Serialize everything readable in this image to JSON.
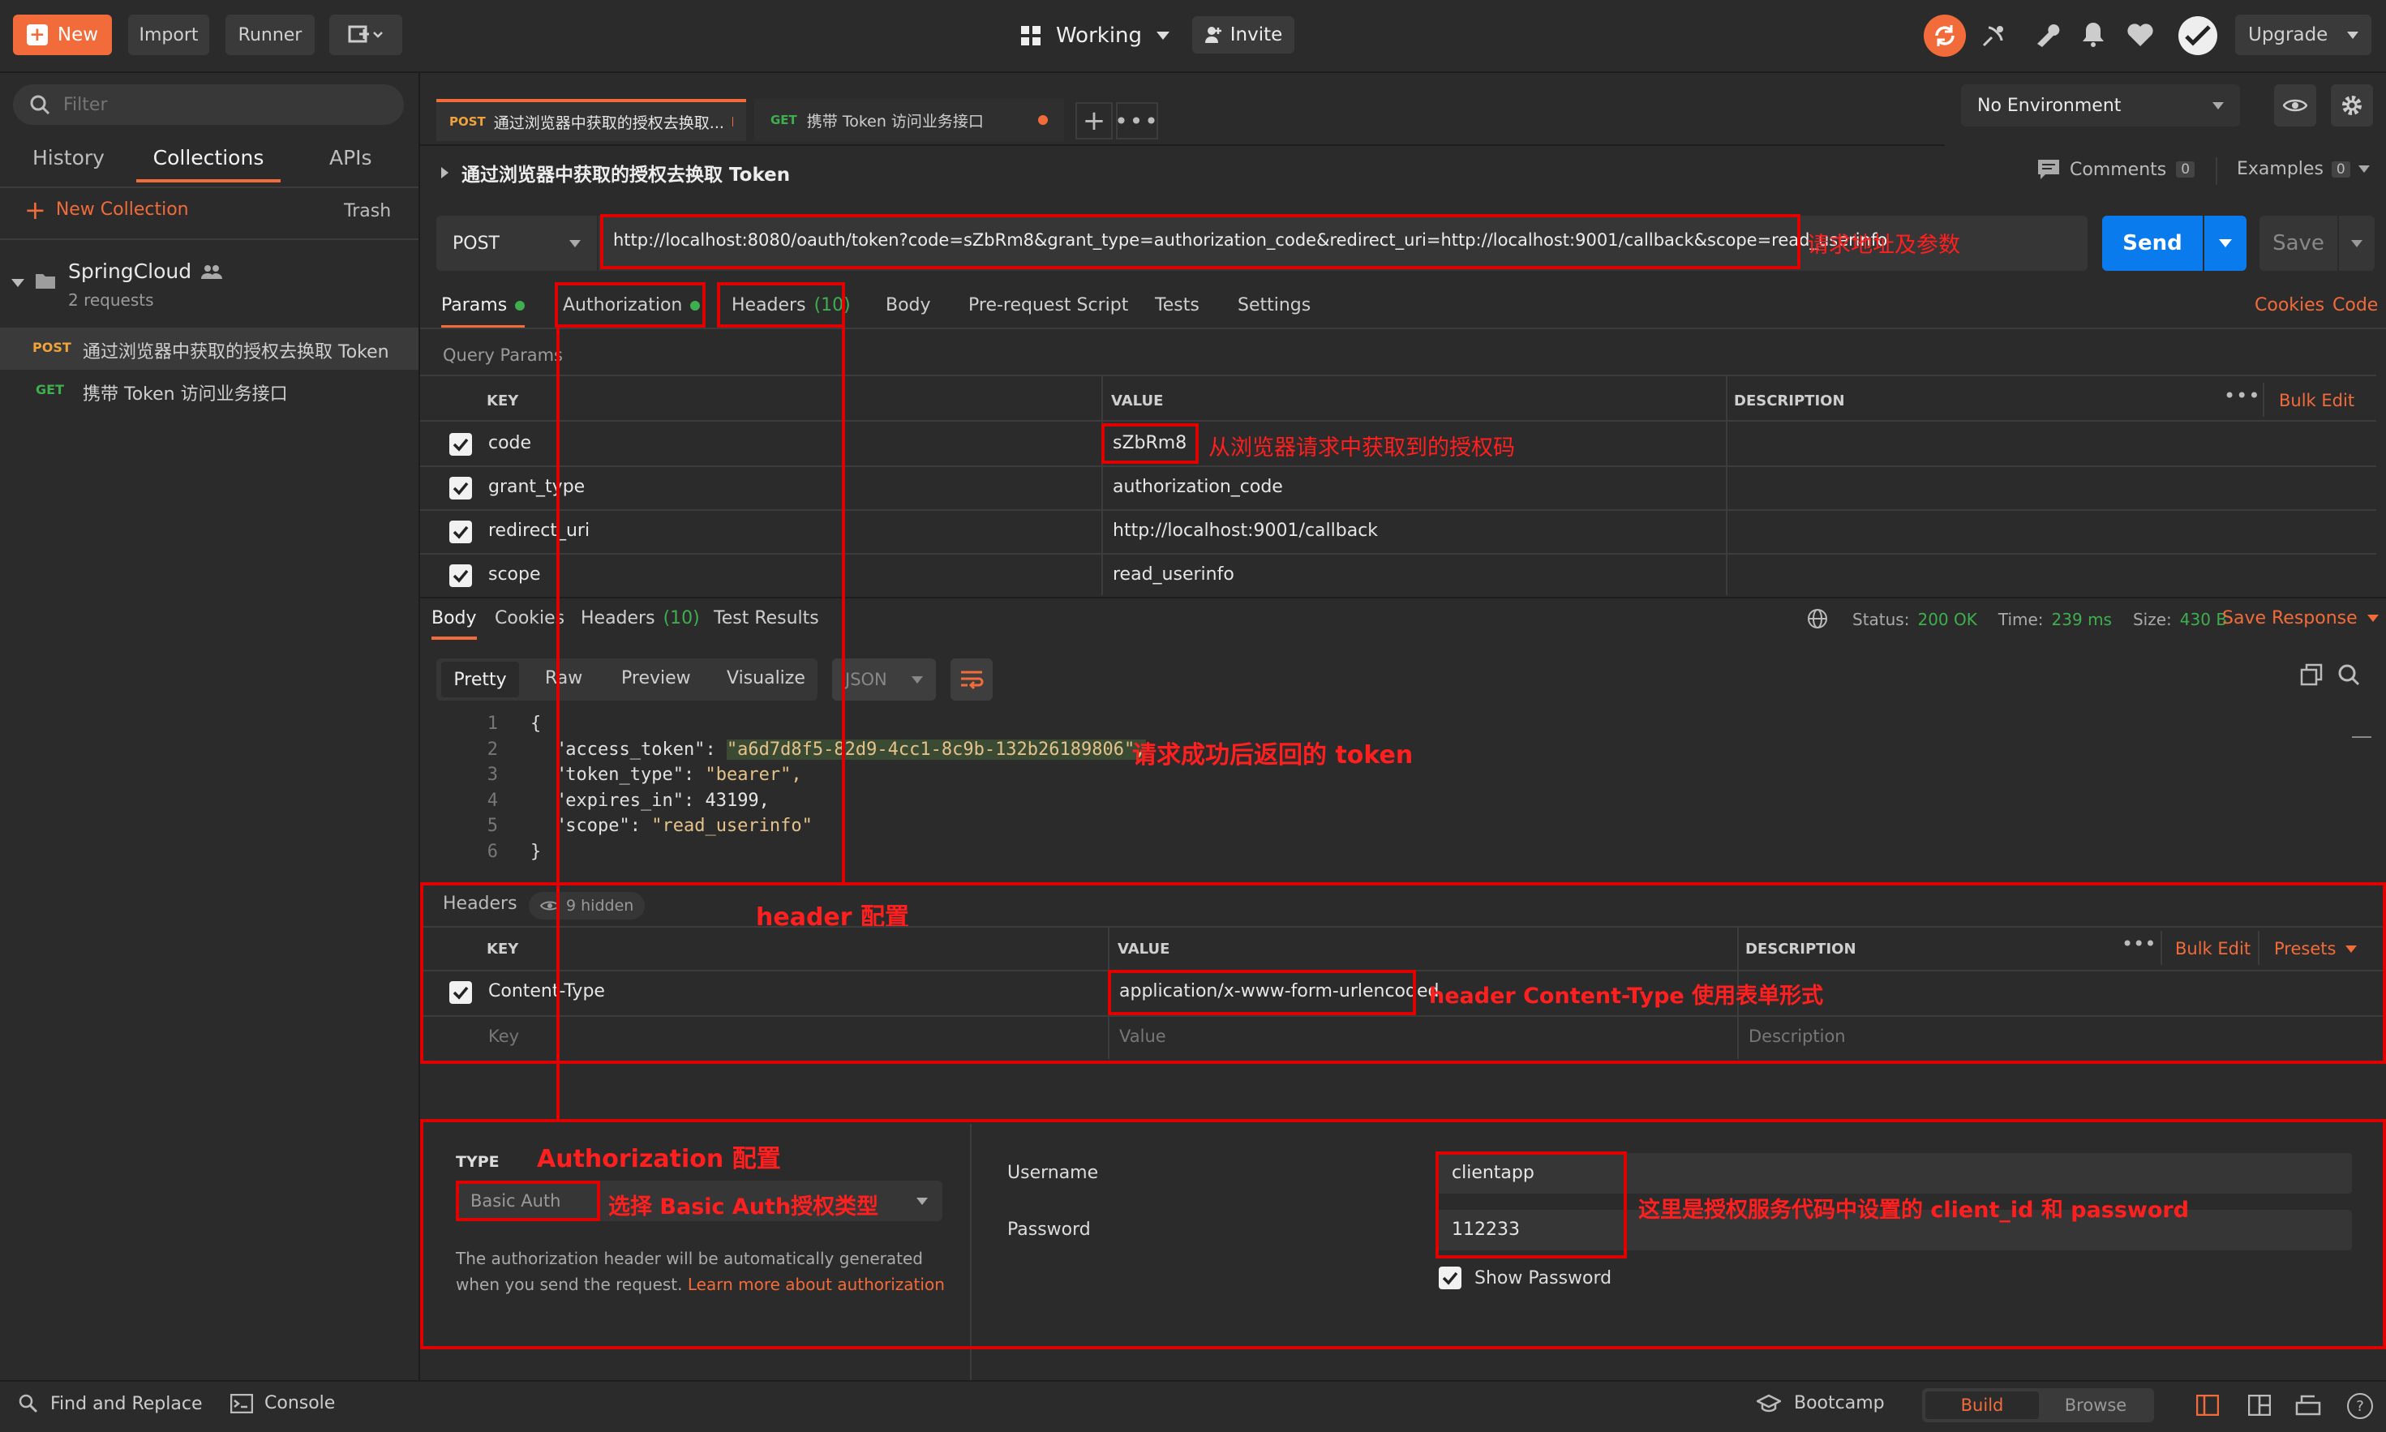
{
  "topbar": {
    "new_label": "New",
    "import_label": "Import",
    "runner_label": "Runner",
    "workspace_label": "Working",
    "invite_label": "Invite",
    "upgrade_label": "Upgrade"
  },
  "sidebar": {
    "filter_placeholder": "Filter",
    "tabs": [
      "History",
      "Collections",
      "APIs"
    ],
    "new_collection_label": "New Collection",
    "trash_label": "Trash",
    "collection": {
      "name": "SpringCloud",
      "count": "2 requests"
    },
    "requests": [
      {
        "method": "POST",
        "name": "通过浏览器中获取的授权去换取 Token"
      },
      {
        "method": "GET",
        "name": "携带 Token 访问业务接口"
      }
    ]
  },
  "tabs": [
    {
      "method": "POST",
      "title": "通过浏览器中获取的授权去换取..."
    },
    {
      "method": "GET",
      "title": "携带 Token 访问业务接口"
    }
  ],
  "environment": {
    "selected": "No Environment"
  },
  "request": {
    "title": "通过浏览器中获取的授权去换取 Token",
    "comments_label": "Comments",
    "comments_count": "0",
    "examples_label": "Examples",
    "examples_count": "0",
    "method": "POST",
    "url": "http://localhost:8080/oauth/token?code=sZbRm8&grant_type=authorization_code&redirect_uri=http://localhost:9001/callback&scope=read_userinfo",
    "send_label": "Send",
    "save_label": "Save"
  },
  "req_tabs": {
    "params": "Params",
    "authorization": "Authorization",
    "headers": "Headers",
    "headers_count": "(10)",
    "body": "Body",
    "prerequest": "Pre-request Script",
    "tests": "Tests",
    "settings": "Settings",
    "cookies": "Cookies",
    "code": "Code"
  },
  "params": {
    "section_label": "Query Params",
    "headers": {
      "key": "KEY",
      "value": "VALUE",
      "description": "DESCRIPTION",
      "bulk_edit": "Bulk Edit"
    },
    "rows": [
      {
        "key": "code",
        "value": "sZbRm8"
      },
      {
        "key": "grant_type",
        "value": "authorization_code"
      },
      {
        "key": "redirect_uri",
        "value": "http://localhost:9001/callback"
      },
      {
        "key": "scope",
        "value": "read_userinfo"
      }
    ]
  },
  "response": {
    "tabs": {
      "body": "Body",
      "cookies": "Cookies",
      "headers": "Headers",
      "headers_count": "(10)",
      "test_results": "Test Results"
    },
    "status_label": "Status:",
    "status_value": "200 OK",
    "time_label": "Time:",
    "time_value": "239 ms",
    "size_label": "Size:",
    "size_value": "430 B",
    "save_response": "Save Response",
    "view_modes": [
      "Pretty",
      "Raw",
      "Preview",
      "Visualize"
    ],
    "format": "JSON",
    "lines": [
      {
        "n": "1",
        "text": "{"
      },
      {
        "n": "2",
        "k": "\"access_token\"",
        "v": "\"a6d7d8f5-82d9-4cc1-8c9b-132b26189806\","
      },
      {
        "n": "3",
        "k": "\"token_type\"",
        "v": "\"bearer\","
      },
      {
        "n": "4",
        "k": "\"expires_in\"",
        "v": "43199,"
      },
      {
        "n": "5",
        "k": "\"scope\"",
        "v": "\"read_userinfo\""
      },
      {
        "n": "6",
        "text": "}"
      }
    ]
  },
  "headers_panel": {
    "title": "Headers",
    "hidden": "9 hidden",
    "cols": {
      "key": "KEY",
      "value": "VALUE",
      "description": "DESCRIPTION",
      "bulk_edit": "Bulk Edit",
      "presets": "Presets"
    },
    "row": {
      "key": "Content-Type",
      "value": "application/x-www-form-urlencoded"
    },
    "placeholder": {
      "key": "Key",
      "value": "Value",
      "description": "Description"
    }
  },
  "auth_panel": {
    "type_label": "TYPE",
    "type_value": "Basic Auth",
    "help": "The authorization header will be automatically generated when you send the request.",
    "learn_more": "Learn more about authorization",
    "username_label": "Username",
    "username_value": "clientapp",
    "password_label": "Password",
    "password_value": "112233",
    "show_password": "Show Password"
  },
  "bottombar": {
    "find_replace": "Find and Replace",
    "console": "Console",
    "bootcamp": "Bootcamp",
    "build": "Build",
    "browse": "Browse"
  },
  "annotations": {
    "url": "请求地址及参数",
    "code": "从浏览器请求中获取到的授权码",
    "token": "请求成功后返回的 token",
    "header_config": "header 配置",
    "content_type": "header  Content-Type 使用表单形式",
    "auth_config": "Authorization 配置",
    "basic_auth": "选择 Basic Auth授权类型",
    "client": "这里是授权服务代码中设置的 client_id 和 password"
  },
  "colors": {
    "accent": "#f26b3a",
    "send": "#097bed",
    "annotation": "#ff1f1f",
    "status_ok": "#3fae4f"
  }
}
